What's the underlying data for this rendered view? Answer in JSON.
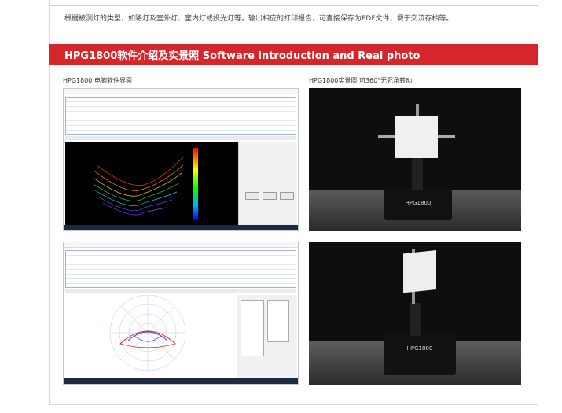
{
  "intro_text": "根据被测灯的类型，如路灯及室外灯、室内灯或投光灯等，输出相应的打印报告，可直接保存为PDF文件，便于交流存档等。",
  "section_title": "HPG1800软件介绍及实景照 Software introduction and Real photo",
  "left_caption": "HPG1800 电脑软件界面",
  "right_caption": "HPG1800实景照 可360°无死角转动",
  "device_label": "HPG1800",
  "colors": {
    "banner": "#d7262b",
    "text": "#333333",
    "border": "#d8d8d8"
  },
  "icons": [
    "software-screenshot",
    "polar-diagram",
    "goniophotometer-photo"
  ]
}
